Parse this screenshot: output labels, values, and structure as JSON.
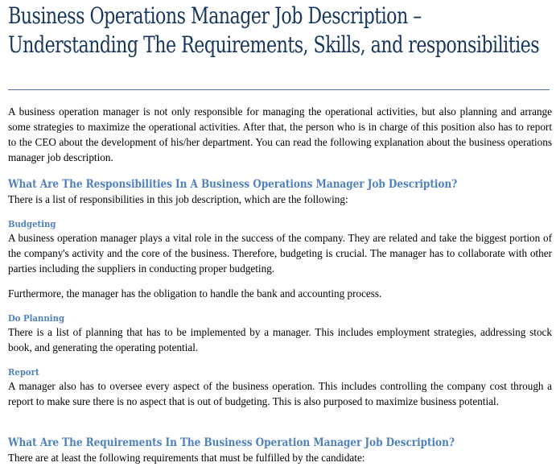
{
  "article": {
    "title": "Business Operations Manager Job Description – Understanding The Requirements, Skills, and responsibilities",
    "intro": "A business operation manager is not only responsible for managing the operational activities, but also planning and arrange some strategies to maximize the operational activities. After that, the person who is in charge of this position also has to report to the CEO about the development of his/her department. You can read the following explanation about the business operations manager job description.",
    "sections": [
      {
        "heading": "What Are The Responsibilities In A Business Operations Manager Job Description?",
        "lead": "There is a list of responsibilities in this job description, which are the following:",
        "subsections": [
          {
            "heading": "Budgeting",
            "paragraphs": [
              "A business operation manager plays a vital role in the success of the company. They are related and take the biggest portion of the company's activity and the core of the business. Therefore, budgeting is crucial. The manager has to collaborate with other parties including the suppliers in conducting proper budgeting.",
              "Furthermore, the manager has the obligation to handle the bank and accounting process."
            ]
          },
          {
            "heading": "Do Planning",
            "paragraphs": [
              "There is a list of planning that has to be implemented by a manager. This includes employment strategies, addressing stock book, and generating the operating potential."
            ]
          },
          {
            "heading": "Report",
            "paragraphs": [
              "A manager also has to oversee every aspect of the business operation. This includes controlling the company cost through a report to make sure there is no aspect that is out of budgeting. This is also purposed to maximize business potential."
            ]
          }
        ]
      },
      {
        "heading": "What Are The Requirements In The Business Operation Manager Job Description?",
        "lead": "There are at least the following requirements that must be fulfilled by the candidate:"
      }
    ]
  },
  "colors": {
    "title": "#17365d",
    "heading": "#4f81bd",
    "rule": "#4f6f95",
    "text": "#000000"
  }
}
